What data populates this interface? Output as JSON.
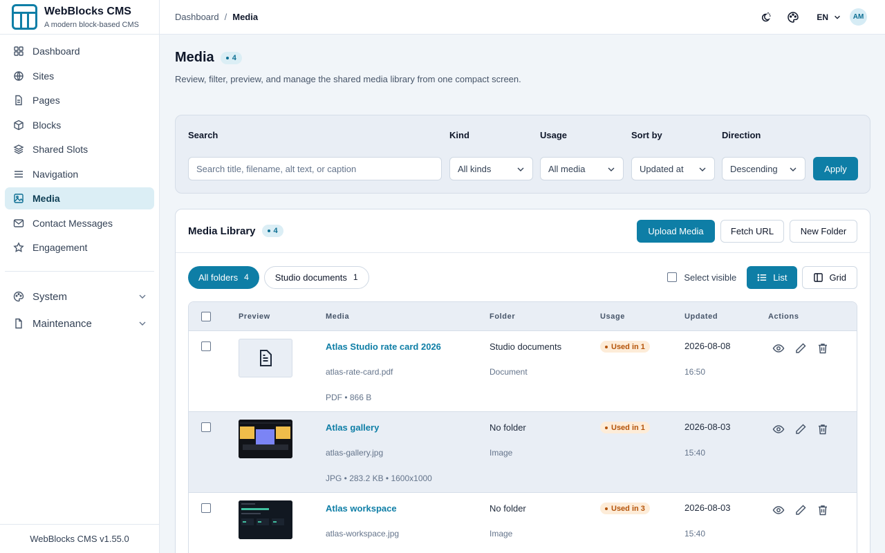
{
  "brand": {
    "name": "WebBlocks CMS",
    "tagline": "A modern block-based CMS"
  },
  "sidebar": {
    "items": [
      {
        "label": "Dashboard",
        "icon": "grid-icon"
      },
      {
        "label": "Sites",
        "icon": "globe-icon"
      },
      {
        "label": "Pages",
        "icon": "file-icon"
      },
      {
        "label": "Blocks",
        "icon": "box-icon"
      },
      {
        "label": "Shared Slots",
        "icon": "layers-icon"
      },
      {
        "label": "Navigation",
        "icon": "menu-icon"
      },
      {
        "label": "Media",
        "icon": "image-icon",
        "active": true
      },
      {
        "label": "Contact Messages",
        "icon": "mail-icon"
      },
      {
        "label": "Engagement",
        "icon": "star-icon"
      }
    ],
    "groups": [
      {
        "label": "System",
        "icon": "palette-icon"
      },
      {
        "label": "Maintenance",
        "icon": "file-icon"
      }
    ],
    "footer": "WebBlocks CMS v1.55.0"
  },
  "topbar": {
    "breadcrumb": {
      "parent": "Dashboard",
      "separator": "/",
      "current": "Media"
    },
    "language": "EN",
    "avatar": "AM"
  },
  "page": {
    "title": "Media",
    "count": "4",
    "subtitle": "Review, filter, preview, and manage the shared media library from one compact screen."
  },
  "filters": {
    "search_label": "Search",
    "search_placeholder": "Search title, filename, alt text, or caption",
    "kind_label": "Kind",
    "kind_value": "All kinds",
    "usage_label": "Usage",
    "usage_value": "All media",
    "sort_label": "Sort by",
    "sort_value": "Updated at",
    "direction_label": "Direction",
    "direction_value": "Descending",
    "apply": "Apply"
  },
  "library": {
    "title": "Media Library",
    "count": "4",
    "upload": "Upload Media",
    "fetch": "Fetch URL",
    "new_folder": "New Folder",
    "folders": [
      {
        "label": "All folders",
        "count": "4",
        "active": true
      },
      {
        "label": "Studio documents",
        "count": "1",
        "active": false
      }
    ],
    "select_visible": "Select visible",
    "view_list": "List",
    "view_grid": "Grid",
    "columns": [
      "Preview",
      "Media",
      "Folder",
      "Usage",
      "Updated",
      "Actions"
    ],
    "rows": [
      {
        "title": "Atlas Studio rate card 2026",
        "file": "atlas-rate-card.pdf",
        "meta": "PDF • 866 B",
        "folder": "Studio documents",
        "kind": "Document",
        "usage": "Used in 1",
        "date": "2026-08-08",
        "time": "16:50",
        "preview": "document"
      },
      {
        "title": "Atlas gallery",
        "file": "atlas-gallery.jpg",
        "meta": "JPG • 283.2 KB • 1600x1000",
        "folder": "No folder",
        "kind": "Image",
        "usage": "Used in 1",
        "date": "2026-08-03",
        "time": "15:40",
        "preview": "gallery"
      },
      {
        "title": "Atlas workspace",
        "file": "atlas-workspace.jpg",
        "meta": "",
        "folder": "No folder",
        "kind": "Image",
        "usage": "Used in 3",
        "date": "2026-08-03",
        "time": "15:40",
        "preview": "workspace"
      }
    ]
  },
  "colors": {
    "accent": "#0e7ea6",
    "usage_badge": "#fdecd8"
  }
}
